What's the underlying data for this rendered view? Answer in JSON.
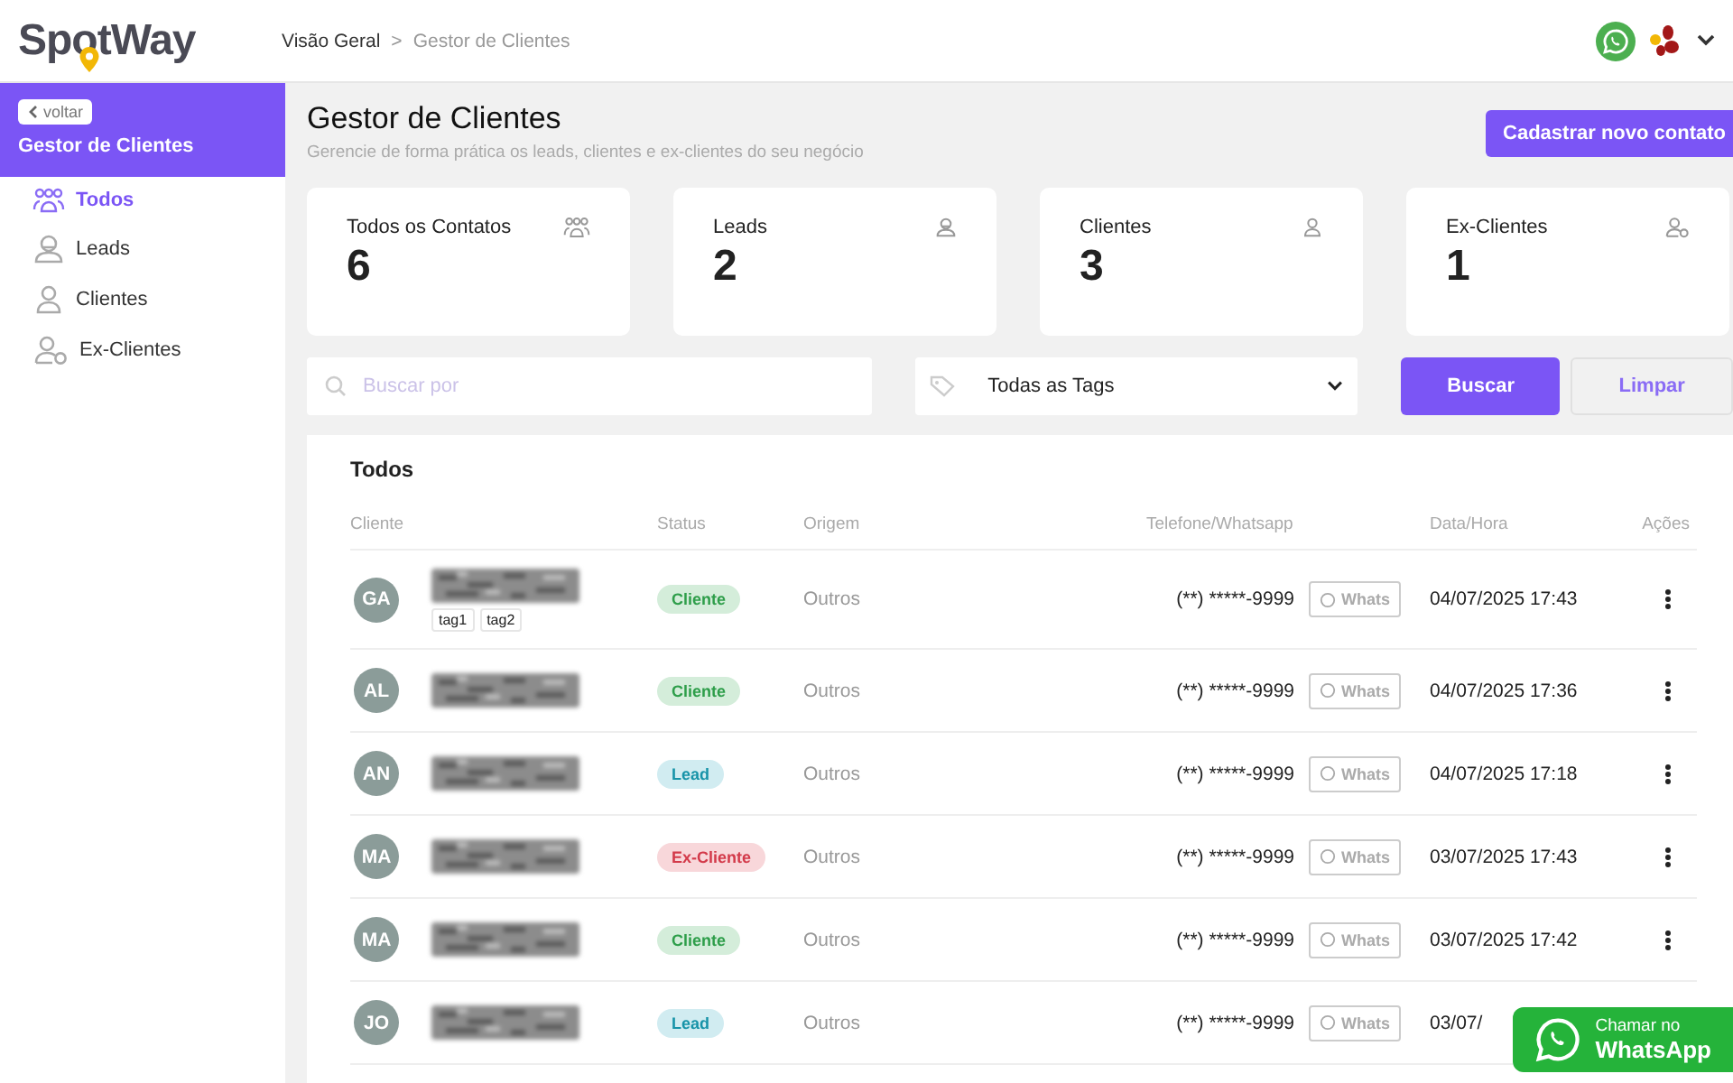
{
  "header": {
    "logo": "SpotWay",
    "breadcrumb": [
      {
        "label": "Visão Geral",
        "current": false
      },
      {
        "label": "Gestor de Clientes",
        "current": true
      }
    ],
    "separator": ">"
  },
  "sidebar": {
    "back": "voltar",
    "title": "Gestor de Clientes",
    "items": [
      {
        "label": "Todos",
        "selected": true
      },
      {
        "label": "Leads",
        "selected": false
      },
      {
        "label": "Clientes",
        "selected": false
      },
      {
        "label": "Ex-Clientes",
        "selected": false
      }
    ]
  },
  "page": {
    "title": "Gestor de Clientes",
    "subtitle": "Gerencie de forma prática os leads, clientes e ex-clientes do seu negócio",
    "new_button": "Cadastrar novo contato"
  },
  "stats": [
    {
      "label": "Todos os Contatos",
      "value": "6"
    },
    {
      "label": "Leads",
      "value": "2"
    },
    {
      "label": "Clientes",
      "value": "3"
    },
    {
      "label": "Ex-Clientes",
      "value": "1"
    }
  ],
  "filters": {
    "search_placeholder": "Buscar por",
    "tags_value": "Todas as Tags",
    "search_button": "Buscar",
    "clear_button": "Limpar"
  },
  "table": {
    "title": "Todos",
    "columns": [
      "Cliente",
      "Status",
      "Origem",
      "Telefone/Whatsapp",
      "Data/Hora",
      "Ações"
    ],
    "rows": [
      {
        "initials": "GA",
        "tags": [
          "tag1",
          "tag2"
        ],
        "status": "Cliente",
        "kind": "cliente",
        "origin": "Outros",
        "phone": "(**) *****-9999",
        "whats": "Whats",
        "date": "04/07/2025 17:43"
      },
      {
        "initials": "AL",
        "tags": [],
        "status": "Cliente",
        "kind": "cliente",
        "origin": "Outros",
        "phone": "(**) *****-9999",
        "whats": "Whats",
        "date": "04/07/2025 17:36"
      },
      {
        "initials": "AN",
        "tags": [],
        "status": "Lead",
        "kind": "lead",
        "origin": "Outros",
        "phone": "(**) *****-9999",
        "whats": "Whats",
        "date": "04/07/2025 17:18"
      },
      {
        "initials": "MA",
        "tags": [],
        "status": "Ex-Cliente",
        "kind": "ex-cliente",
        "origin": "Outros",
        "phone": "(**) *****-9999",
        "whats": "Whats",
        "date": "03/07/2025 17:43"
      },
      {
        "initials": "MA",
        "tags": [],
        "status": "Cliente",
        "kind": "cliente",
        "origin": "Outros",
        "phone": "(**) *****-9999",
        "whats": "Whats",
        "date": "03/07/2025 17:42"
      },
      {
        "initials": "JO",
        "tags": [],
        "status": "Lead",
        "kind": "lead",
        "origin": "Outros",
        "phone": "(**) *****-9999",
        "whats": "Whats",
        "date": "03/07/"
      }
    ]
  },
  "chat_button": {
    "line1": "Chamar no",
    "line2": "WhatsApp"
  }
}
